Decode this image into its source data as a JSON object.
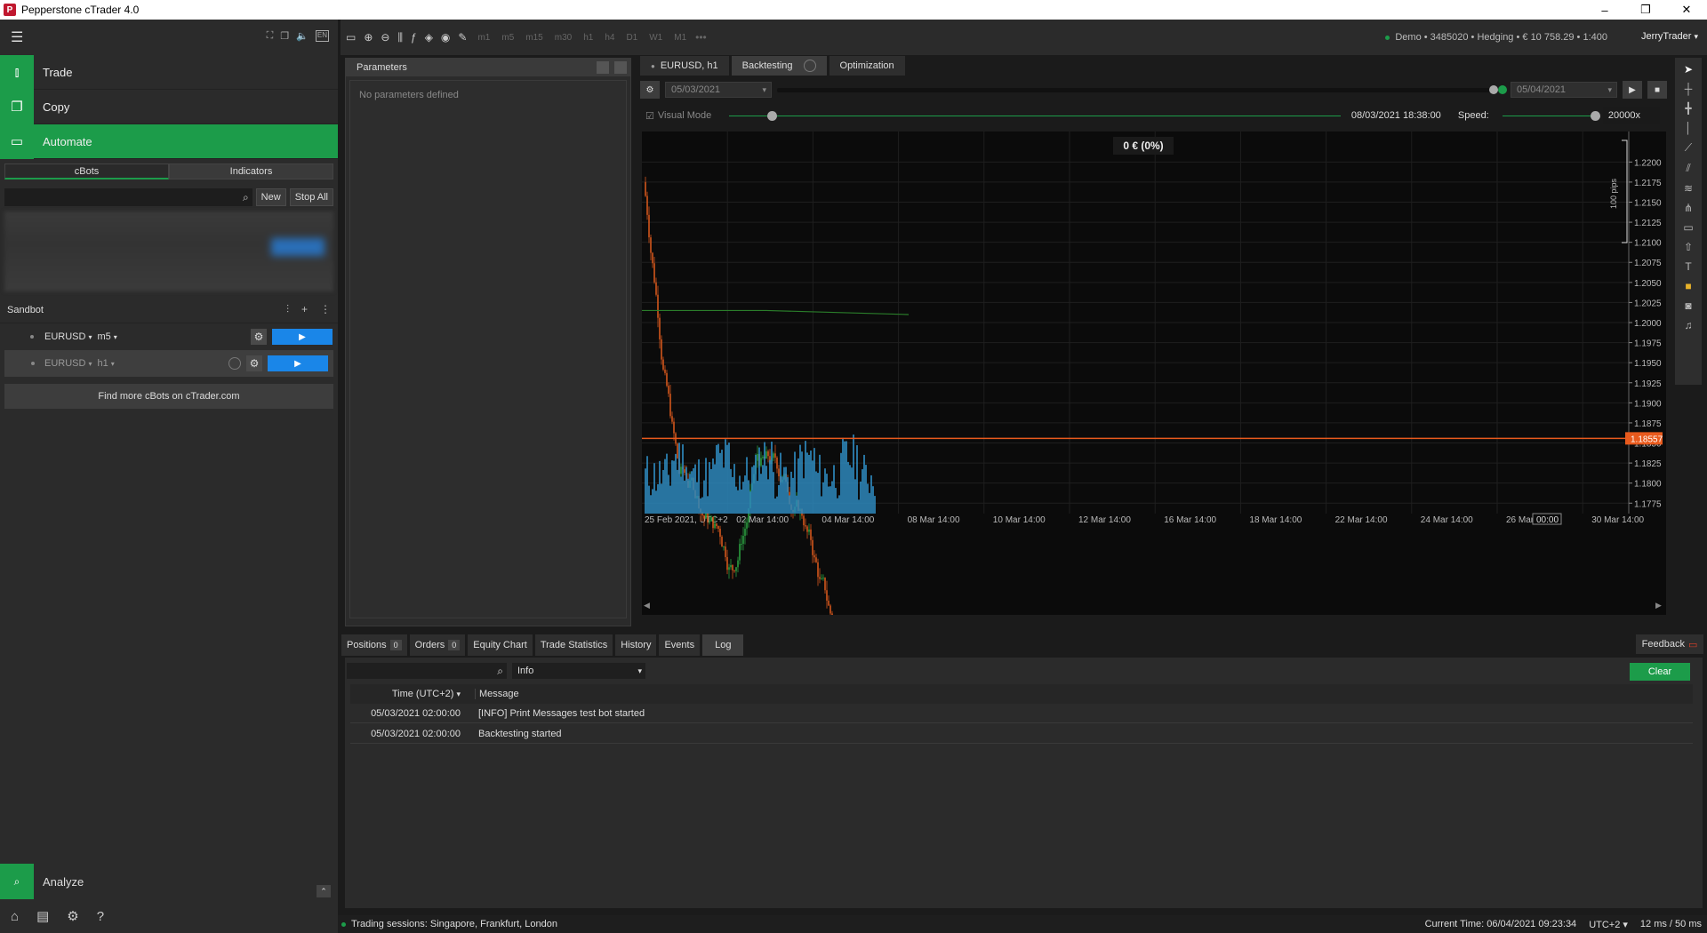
{
  "window": {
    "title": "Pepperstone cTrader 4.0",
    "logo": "P",
    "minimize": "–",
    "maximize": "❐",
    "close": "✕"
  },
  "nav": {
    "trade": "Trade",
    "copy": "Copy",
    "automate": "Automate",
    "analyze": "Analyze"
  },
  "toolbar": {
    "account": "Demo • 3485020 • Hedging • € 10 758.29 • 1:400",
    "user": "JerryTrader",
    "timeframes": [
      "m1",
      "m5",
      "m15",
      "m30",
      "h1",
      "h4",
      "D1",
      "W1",
      "M1"
    ]
  },
  "automate": {
    "tabs": [
      "cBots",
      "Indicators"
    ],
    "new_label": "New",
    "stop_all_label": "Stop All",
    "group": "Sandbot",
    "instances": [
      {
        "symbol": "EURUSD",
        "tf": "m5"
      },
      {
        "symbol": "EURUSD",
        "tf": "h1"
      }
    ],
    "find_more": "Find more cBots on cTrader.com"
  },
  "parameters": {
    "title": "Parameters",
    "empty": "No parameters defined"
  },
  "chart_tabs": [
    "EURUSD, h1",
    "Backtesting",
    "Optimization"
  ],
  "backtest": {
    "start_date": "05/03/2021",
    "end_date": "05/04/2021",
    "visual_mode": "Visual Mode",
    "progress": 0.07,
    "current_time": "08/03/2021 18:38:00",
    "speed_label": "Speed:",
    "speed": "20000x"
  },
  "chart_data": {
    "type": "candlestick",
    "symbol": "EURUSD",
    "timeframe": "h1",
    "pnl": "0 € (0%)",
    "scale_label": "100 pips",
    "ylim": [
      1.1762,
      1.2238
    ],
    "yticks": [
      "1.2200",
      "1.2175",
      "1.2150",
      "1.2125",
      "1.2100",
      "1.2075",
      "1.2050",
      "1.2025",
      "1.2000",
      "1.1975",
      "1.1950",
      "1.1925",
      "1.1900",
      "1.1875",
      "1.1850",
      "1.1825",
      "1.1800",
      "1.1775"
    ],
    "xticks": [
      "25 Feb 2021, UTC+2",
      "02 Mar 14:00",
      "04 Mar 14:00",
      "08 Mar 14:00",
      "10 Mar 14:00",
      "12 Mar 14:00",
      "16 Mar 14:00",
      "18 Mar 14:00",
      "22 Mar 14:00",
      "24 Mar 14:00",
      "26 Mar 14:00",
      "30 Mar 14:00"
    ],
    "current_price": "1.18557",
    "current_price_value": 1.18557,
    "cursor_time": "00:00",
    "colors": {
      "up": "#2a9d3f",
      "down": "#d2561c",
      "volume": "#2f8fc6",
      "price_line": "#e85a1d",
      "ma": "#2a7d2a"
    }
  },
  "bottom_tabs": [
    {
      "label": "Positions",
      "count": "0"
    },
    {
      "label": "Orders",
      "count": "0"
    },
    {
      "label": "Equity Chart"
    },
    {
      "label": "Trade Statistics"
    },
    {
      "label": "History"
    },
    {
      "label": "Events"
    },
    {
      "label": "Log"
    }
  ],
  "feedback": "Feedback",
  "log": {
    "filter": "Info",
    "clear": "Clear",
    "headers": {
      "time": "Time (UTC+2)",
      "message": "Message"
    },
    "rows": [
      {
        "time": "05/03/2021 02:00:00",
        "message": "[INFO] Print Messages test bot started"
      },
      {
        "time": "05/03/2021 02:00:00",
        "message": "Backtesting started"
      }
    ]
  },
  "status": {
    "sessions": "Trading sessions: Singapore, Frankfurt, London",
    "current_time": "Current Time: 06/04/2021 09:23:34",
    "tz": "UTC+2",
    "latency": "12 ms / 50 ms"
  }
}
